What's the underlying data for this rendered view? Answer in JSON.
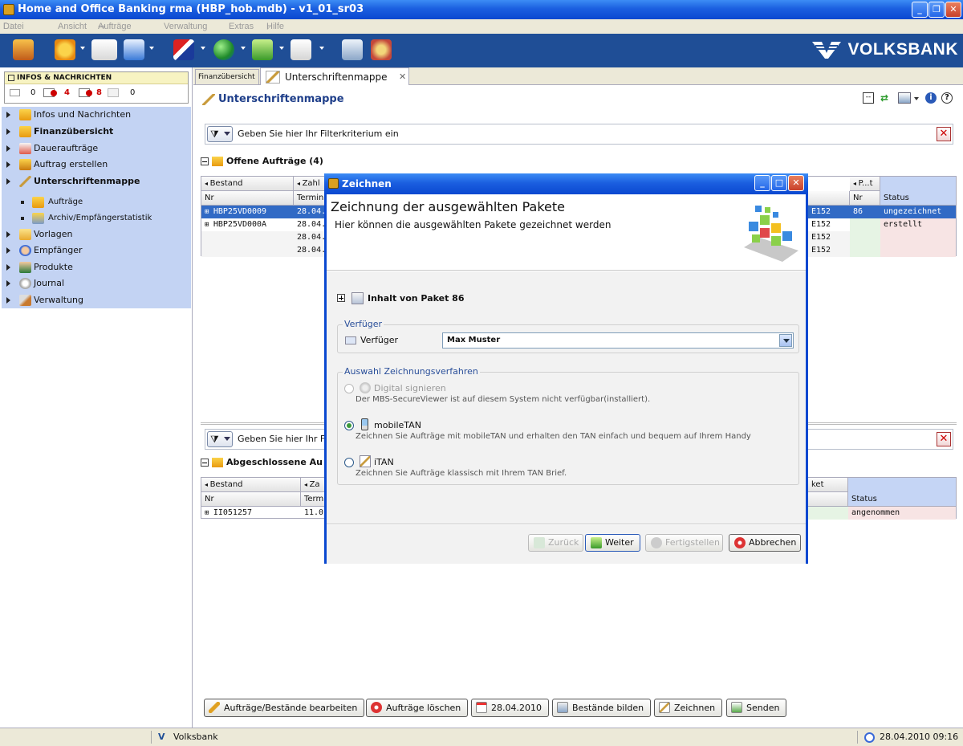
{
  "window": {
    "title": "Home and Office Banking rma (HBP_hob.mdb) - v1_01_sr03"
  },
  "menu": [
    "Datei",
    "Ansicht",
    "Aufträge",
    "Verwaltung",
    "Extras",
    "Hilfe"
  ],
  "brand": "VOLKSBANK",
  "infobox": {
    "title": "INFOS & NACHRICHTEN",
    "counts": [
      "0",
      "4",
      "8",
      "0"
    ]
  },
  "nav": {
    "items": [
      {
        "label": "Infos und Nachrichten",
        "bold": false
      },
      {
        "label": "Finanzübersicht",
        "bold": true
      },
      {
        "label": "Daueraufträge",
        "bold": false
      },
      {
        "label": "Auftrag erstellen",
        "bold": false
      },
      {
        "label": "Unterschriftenmappe",
        "bold": true
      }
    ],
    "subitems": [
      "Aufträge",
      "Archiv/Empfängerstatistik"
    ],
    "items2": [
      "Vorlagen",
      "Empfänger",
      "Produkte",
      "Journal",
      "Verwaltung"
    ]
  },
  "tabs": {
    "tab1": "Finanzübersicht",
    "tab2": "Unterschriftenmappe"
  },
  "main": {
    "title": "Unterschriftenmappe",
    "filter_placeholder": "Geben Sie hier Ihr Filterkriterium ein",
    "filter_placeholder_short": "Geben Sie hier Ihr F",
    "open_section": "Offene Aufträge (4)",
    "closed_section": "Abgeschlossene Au",
    "open_grid": {
      "group_headers": [
        "Bestand",
        "Zahl",
        "P...t"
      ],
      "headers": [
        "Nr",
        "Termin",
        "Nr",
        "Status"
      ],
      "rows": [
        {
          "nr": "HBP25VD0009",
          "termin": "28.04.",
          "acct": "E152",
          "pnr": "86",
          "status": "ungezeichnet"
        },
        {
          "nr": "HBP25VD000A",
          "termin": "28.04.",
          "acct": "E152",
          "pnr": "",
          "status": "erstellt"
        },
        {
          "nr": "",
          "termin": "28.04.",
          "acct": "E152",
          "pnr": "",
          "status": ""
        },
        {
          "nr": "",
          "termin": "28.04.",
          "acct": "E152",
          "pnr": "",
          "status": ""
        }
      ]
    },
    "closed_grid": {
      "group_headers": [
        "Bestand",
        "Za",
        "ket"
      ],
      "headers": [
        "Nr",
        "Termi",
        "Status"
      ],
      "rows": [
        {
          "nr": "II051257",
          "termin": "11.0",
          "status": "angenommen"
        }
      ]
    }
  },
  "bottom_buttons": [
    "Aufträge/Bestände bearbeiten",
    "Aufträge löschen",
    "28.04.2010",
    "Bestände bilden",
    "Zeichnen",
    "Senden"
  ],
  "statusbar": {
    "bank": "Volksbank",
    "datetime": "28.04.2010 09:16"
  },
  "dialog": {
    "title": "Zeichnen",
    "heading": "Zeichnung der ausgewählten Pakete",
    "subheading": "Hier können die ausgewählten Pakete gezeichnet werden",
    "paket": "Inhalt von Paket 86",
    "verfueger_group": "Verfüger",
    "verfueger_label": "Verfüger",
    "verfueger_value": "Max Muster",
    "auswahl_group": "Auswahl Zeichnungsverfahren",
    "options": [
      {
        "label": "Digital signieren",
        "desc": "Der MBS-SecureViewer ist auf diesem System nicht verfügbar(installiert).",
        "selected": false,
        "disabled": true
      },
      {
        "label": "mobileTAN",
        "desc": "Zeichnen Sie Aufträge mit mobileTAN und erhalten den TAN einfach und bequem auf Ihrem Handy",
        "selected": true,
        "disabled": false
      },
      {
        "label": "iTAN",
        "desc": "Zeichnen Sie Aufträge klassisch mit Ihrem TAN Brief.",
        "selected": false,
        "disabled": false
      }
    ],
    "buttons": {
      "back": "Zurück",
      "next": "Weiter",
      "finish": "Fertigstellen",
      "cancel": "Abbrechen"
    }
  }
}
